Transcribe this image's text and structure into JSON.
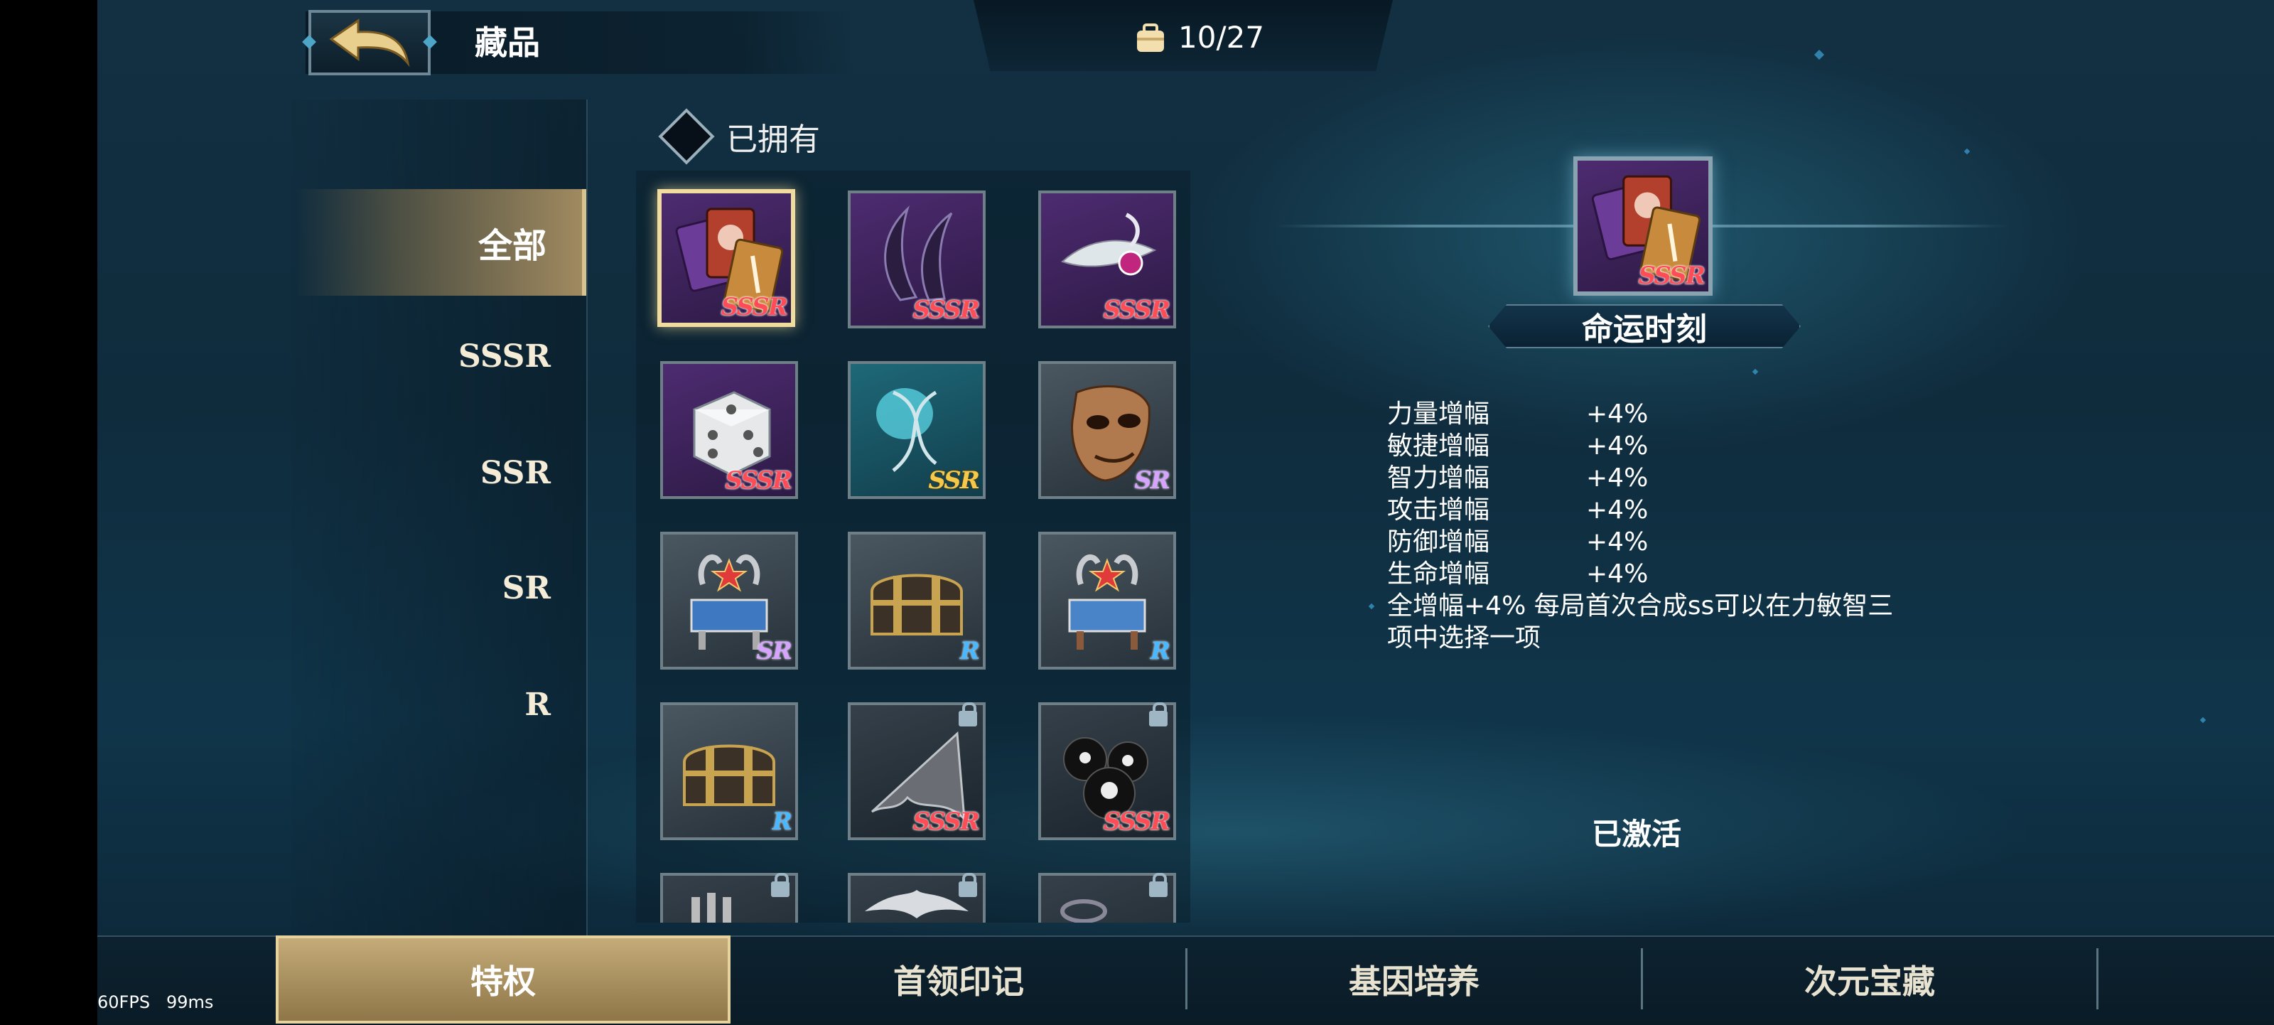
{
  "header": {
    "back_icon": "back-arrow-icon",
    "title": "藏品",
    "bag_icon": "bag-icon",
    "count": "10/27"
  },
  "categories": [
    {
      "label": "全部",
      "active": true
    },
    {
      "label": "SSSR",
      "active": false
    },
    {
      "label": "SSR",
      "active": false
    },
    {
      "label": "SR",
      "active": false
    },
    {
      "label": "R",
      "active": false
    }
  ],
  "filter": {
    "owned_label": "已拥有",
    "checked": false
  },
  "items": [
    {
      "icon": "fate-cards-icon",
      "rarity": "SSSR",
      "locked": false,
      "selected": true
    },
    {
      "icon": "claws-icon",
      "rarity": "SSSR",
      "locked": false
    },
    {
      "icon": "feather-gem-icon",
      "rarity": "SSSR",
      "locked": false
    },
    {
      "icon": "dice-icon",
      "rarity": "SSSR",
      "locked": false
    },
    {
      "icon": "hourglass-icon",
      "rarity": "SSR",
      "locked": false
    },
    {
      "icon": "mask-icon",
      "rarity": "SR",
      "locked": false
    },
    {
      "icon": "trophy-box-icon",
      "rarity": "SR",
      "locked": false
    },
    {
      "icon": "chest-icon",
      "rarity": "R",
      "locked": false
    },
    {
      "icon": "trophy-box-icon",
      "rarity": "R",
      "locked": false
    },
    {
      "icon": "chest-icon",
      "rarity": "R",
      "locked": false
    },
    {
      "icon": "bat-wing-icon",
      "rarity": "SSSR",
      "locked": true
    },
    {
      "icon": "skull-bombs-icon",
      "rarity": "SSSR",
      "locked": true
    },
    {
      "icon": "bones-icon",
      "rarity": "",
      "locked": true
    },
    {
      "icon": "winged-emblem-icon",
      "rarity": "",
      "locked": true
    },
    {
      "icon": "ring-icon",
      "rarity": "",
      "locked": true
    }
  ],
  "detail": {
    "icon": "fate-cards-icon",
    "rarity": "SSSR",
    "name": "命运时刻",
    "stats": [
      {
        "label": "力量增幅",
        "value": "+4%"
      },
      {
        "label": "敏捷增幅",
        "value": "+4%"
      },
      {
        "label": "智力增幅",
        "value": "+4%"
      },
      {
        "label": "攻击增幅",
        "value": "+4%"
      },
      {
        "label": "防御增幅",
        "value": "+4%"
      },
      {
        "label": "生命增幅",
        "value": "+4%"
      }
    ],
    "description": "全增幅+4% 每局首次合成ss可以在力敏智三项中选择一项",
    "status": "已激活"
  },
  "tabs": [
    {
      "label": "特权",
      "active": true
    },
    {
      "label": "首领印记",
      "active": false
    },
    {
      "label": "基因培养",
      "active": false
    },
    {
      "label": "次元宝藏",
      "active": false
    }
  ],
  "overlay": {
    "fps": "60FPS",
    "ping": "99ms"
  }
}
